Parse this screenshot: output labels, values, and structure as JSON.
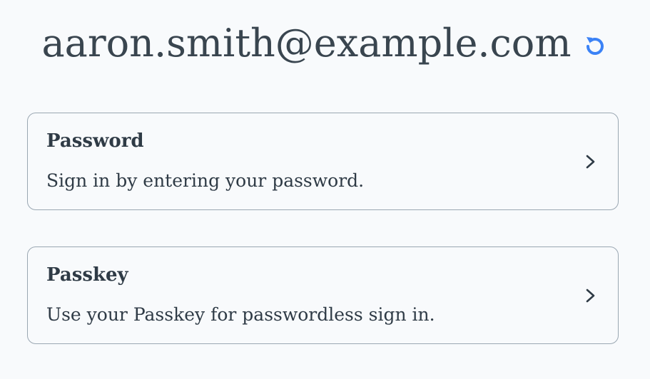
{
  "header": {
    "email": "aaron.smith@example.com",
    "reset_icon": "reset-icon",
    "accent_color": "#3b82f6"
  },
  "options": [
    {
      "title": "Password",
      "description": "Sign in by entering your password.",
      "icon": "chevron-right-icon"
    },
    {
      "title": "Passkey",
      "description": "Use your Passkey for passwordless sign in.",
      "icon": "chevron-right-icon"
    }
  ]
}
